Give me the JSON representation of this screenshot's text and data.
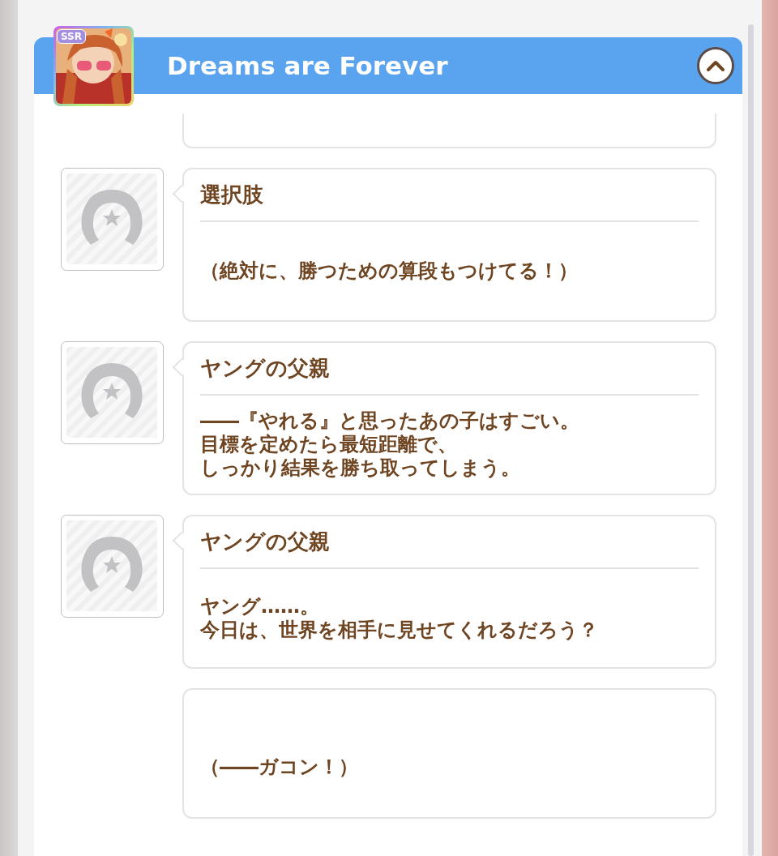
{
  "header": {
    "title": "Dreams are Forever",
    "card": {
      "rarity": "SSR",
      "kind": "picture"
    },
    "expanded": true
  },
  "messages": [
    {
      "kind": "cut"
    },
    {
      "kind": "speech",
      "speaker": "選択肢",
      "lines": [
        "（絶対に、勝つための算段もつけてる！）"
      ]
    },
    {
      "kind": "speech",
      "speaker": "ヤングの父親",
      "lines": [
        "――『やれる』と思ったあの子はすごい。",
        "目標を定めたら最短距離で、",
        "しっかり結果を勝ち取ってしまう。"
      ]
    },
    {
      "kind": "speech",
      "speaker": "ヤングの父親",
      "lines": [
        "ヤング……。",
        "今日は、世界を相手に見せてくれるだろう？"
      ]
    },
    {
      "kind": "narration",
      "lines": [
        "（――ガコン！）"
      ]
    }
  ]
}
